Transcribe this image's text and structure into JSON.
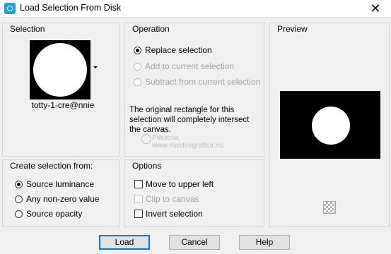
{
  "window": {
    "title": "Load Selection From Disk",
    "close_label": "✕"
  },
  "selection": {
    "group_label": "Selection",
    "name": "totty-1-cre@nnie"
  },
  "operation": {
    "group_label": "Operation",
    "options": [
      {
        "label": "Replace selection",
        "checked": true,
        "enabled": true
      },
      {
        "label": "Add to current selection",
        "checked": false,
        "enabled": false
      },
      {
        "label": "Subtract from current selection",
        "checked": false,
        "enabled": false
      }
    ],
    "info": "The original rectangle for this selection will completely intersect the canvas."
  },
  "preview": {
    "group_label": "Preview"
  },
  "create_from": {
    "group_label": "Create selection from:",
    "options": [
      {
        "label": "Source luminance",
        "checked": true
      },
      {
        "label": "Any non-zero value",
        "checked": false
      },
      {
        "label": "Source opacity",
        "checked": false
      }
    ]
  },
  "options": {
    "group_label": "Options",
    "items": [
      {
        "label": "Move to upper left",
        "checked": false,
        "enabled": true
      },
      {
        "label": "Clip to canvas",
        "checked": false,
        "enabled": false
      },
      {
        "label": "Invert selection",
        "checked": false,
        "enabled": true
      }
    ]
  },
  "watermark": {
    "line1": "Pinuccia",
    "line2": "www.maidiregrafica.eu"
  },
  "buttons": {
    "load": "Load",
    "cancel": "Cancel",
    "help": "Help"
  },
  "colors": {
    "accent": "#0078d7",
    "title_icon": "#1ba1d8"
  }
}
